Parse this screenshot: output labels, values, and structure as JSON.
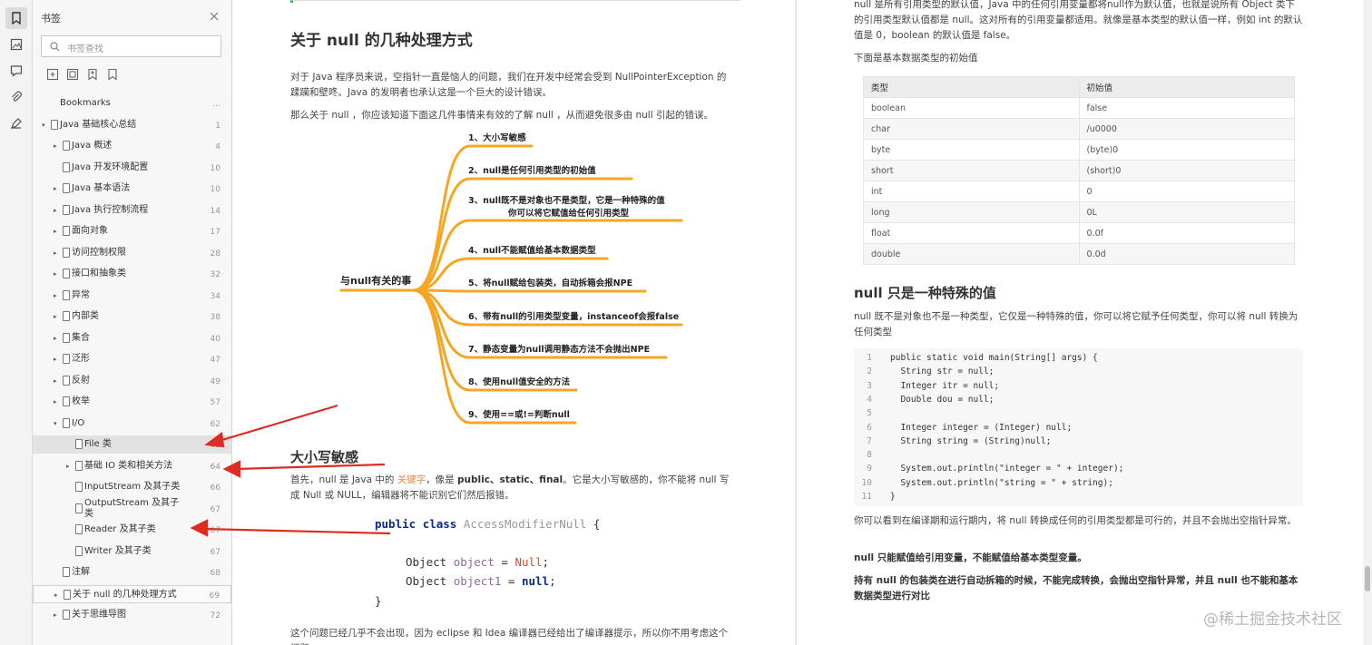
{
  "sidebar": {
    "title": "书签",
    "search_placeholder": "书签查找",
    "items": [
      {
        "label": "Bookmarks",
        "page": "...",
        "depth": 0,
        "kind": "root"
      },
      {
        "label": "Java 基础核心总结",
        "page": "1",
        "depth": 0,
        "kind": "expanded"
      },
      {
        "label": "Java 概述",
        "page": "4",
        "depth": 1,
        "kind": "collapsed"
      },
      {
        "label": "Java 开发环境配置",
        "page": "10",
        "depth": 1,
        "kind": "leaf"
      },
      {
        "label": "Java 基本语法",
        "page": "10",
        "depth": 1,
        "kind": "collapsed"
      },
      {
        "label": "Java 执行控制流程",
        "page": "14",
        "depth": 1,
        "kind": "collapsed"
      },
      {
        "label": "面向对象",
        "page": "17",
        "depth": 1,
        "kind": "collapsed"
      },
      {
        "label": "访问控制权限",
        "page": "28",
        "depth": 1,
        "kind": "collapsed"
      },
      {
        "label": "接口和抽象类",
        "page": "32",
        "depth": 1,
        "kind": "collapsed"
      },
      {
        "label": "异常",
        "page": "34",
        "depth": 1,
        "kind": "collapsed"
      },
      {
        "label": "内部类",
        "page": "38",
        "depth": 1,
        "kind": "collapsed"
      },
      {
        "label": "集合",
        "page": "40",
        "depth": 1,
        "kind": "collapsed"
      },
      {
        "label": "泛形",
        "page": "47",
        "depth": 1,
        "kind": "collapsed"
      },
      {
        "label": "反射",
        "page": "49",
        "depth": 1,
        "kind": "collapsed"
      },
      {
        "label": "枚举",
        "page": "57",
        "depth": 1,
        "kind": "collapsed"
      },
      {
        "label": "I/O",
        "page": "62",
        "depth": 1,
        "kind": "expanded"
      },
      {
        "label": "File 类",
        "page": "63",
        "depth": 2,
        "kind": "leaf",
        "selected": true
      },
      {
        "label": "基础 IO 类和相关方法",
        "page": "64",
        "depth": 2,
        "kind": "collapsed"
      },
      {
        "label": "InputStream 及其子类",
        "page": "66",
        "depth": 2,
        "kind": "leaf"
      },
      {
        "label": "OutputStream 及其子类",
        "page": "67",
        "depth": 2,
        "kind": "leaf"
      },
      {
        "label": "Reader 及其子类",
        "page": "67",
        "depth": 2,
        "kind": "leaf"
      },
      {
        "label": "Writer 及其子类",
        "page": "67",
        "depth": 2,
        "kind": "leaf"
      },
      {
        "label": "注解",
        "page": "68",
        "depth": 1,
        "kind": "leaf"
      },
      {
        "label": "关于 null 的几种处理方式",
        "page": "69",
        "depth": 1,
        "kind": "collapsed",
        "outlined": true
      },
      {
        "label": "关于思维导图",
        "page": "72",
        "depth": 1,
        "kind": "collapsed"
      }
    ]
  },
  "page1": {
    "heading": "关于 null 的几种处理方式",
    "intro1": "对于 Java 程序员来说，空指针一直是恼人的问题，我们在开发中经常会受到 NullPointerException 的蹂躏和壁咚。Java 的发明者也承认这是一个巨大的设计错误。",
    "intro2": "那么关于 null ，你应该知道下面这几件事情来有效的了解 null ，从而避免很多由 null 引起的错误。",
    "mindmap_root": "与null有关的事",
    "mindmap_items": [
      "1、大小写敏感",
      "2、null是任何引用类型的初始值",
      "3、null既不是对象也不是类型，它是一种特殊的值",
      "4、null不能赋值给基本数据类型",
      "5、将null赋给包装类，自动拆箱会报NPE",
      "6、带有null的引用类型变量，instanceof会报false",
      "7、静态变量为null调用静态方法不会抛出NPE",
      "8、使用null值安全的方法",
      "9、使用==或!=判断null"
    ],
    "mindmap_item3_line2": "你可以将它赋值给任何引用类型",
    "sub_heading": "大小写敏感",
    "body_before": "首先，null 是 Java 中的",
    "body_keyword": "关键字",
    "body_mid": "，像是",
    "body_bold": "public、static、final",
    "body_after": "。它是大小写敏感的，你不能将 null 写成 Null 或 NULL，编辑器将不能识别它们然后报错。",
    "code_kw1": "public",
    "code_kw2": "class",
    "code_classname": "AccessModifierNull",
    "code_brace_open": "{",
    "code_type": "Object",
    "code_var1": "object",
    "code_eq": "=",
    "code_null_wrong": "Null",
    "code_semi": ";",
    "code_var2": "object1",
    "code_null_right": "null",
    "code_brace_close": "}",
    "footer_text": "这个问题已经几乎不会出现，因为 eclipse 和 Idea 编译器已经给出了编译器提示，所以你不用考虑这个问题。"
  },
  "page2": {
    "top_text": "null 是所有引用类型的默认值，Java 中的任何引用变量都将null作为默认值，也就是说所有 Object 类下的引用类型默认值都是 null。这对所有的引用变量都适用。就像是基本类型的默认值一样，例如 int 的默认值是 0，boolean 的默认值是 false。",
    "table_intro": "下面是基本数据类型的初始值",
    "table_headers": [
      "类型",
      "初始值"
    ],
    "table_rows": [
      [
        "boolean",
        "false"
      ],
      [
        "char",
        "/u0000"
      ],
      [
        "byte",
        "(byte)0"
      ],
      [
        "short",
        "(short)0"
      ],
      [
        "int",
        "0"
      ],
      [
        "long",
        "0L"
      ],
      [
        "float",
        "0.0f"
      ],
      [
        "double",
        "0.0d"
      ]
    ],
    "heading": "null 只是一种特殊的值",
    "para1": "null 既不是对象也不是一种类型，它仅是一种特殊的值，你可以将它赋予任何类型，你可以将 null 转换为任何类型",
    "code_lines": [
      {
        "n": "1",
        "t": "public static void main(String[] args) {"
      },
      {
        "n": "2",
        "t": "  String str = null;"
      },
      {
        "n": "3",
        "t": "  Integer itr = null;"
      },
      {
        "n": "4",
        "t": "  Double dou = null;"
      },
      {
        "n": "5",
        "t": ""
      },
      {
        "n": "6",
        "t": "  Integer integer = (Integer) null;"
      },
      {
        "n": "7",
        "t": "  String string = (String)null;"
      },
      {
        "n": "8",
        "t": ""
      },
      {
        "n": "9",
        "t": "  System.out.println(\"integer = \" + integer);"
      },
      {
        "n": "10",
        "t": "  System.out.println(\"string = \" + string);"
      },
      {
        "n": "11",
        "t": "}"
      }
    ],
    "para2": "你可以看到在编译期和运行期内，将 null 转换成任何的引用类型都是可行的，并且不会抛出空指针异常。",
    "para3": "null 只能赋值给引用变量，不能赋值给基本类型变量。",
    "para4": "持有 null 的包装类在进行自动拆箱的时候，不能完成转换，会抛出空指针异常，并且 null 也不能和基本数据类型进行对比"
  },
  "watermark": "@稀土掘金技术社区",
  "colors": {
    "mindmap_orange": "#f5a623",
    "arrow_red": "#e02b20",
    "keyword_orange": "#e8863c"
  },
  "icons": {
    "rail": [
      "bookmark-icon",
      "thumbnail-icon",
      "comment-icon",
      "attachment-icon",
      "signature-icon"
    ],
    "toolbar": [
      "expand-all-icon",
      "collapse-all-icon",
      "add-bookmark-icon",
      "bookmark-settings-icon"
    ]
  }
}
